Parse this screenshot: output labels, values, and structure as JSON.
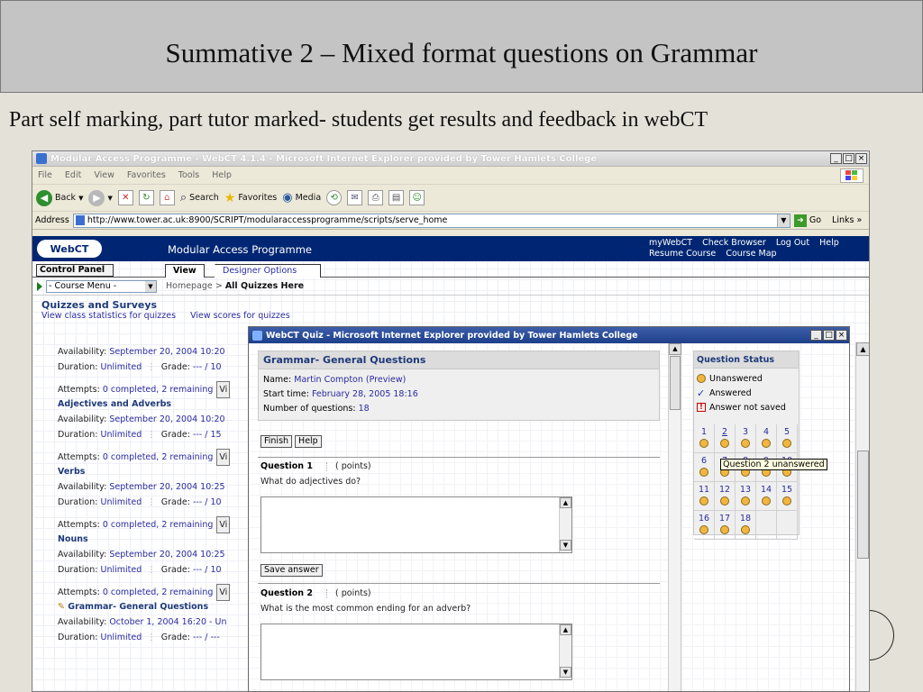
{
  "slide": {
    "title": "Summative 2 – Mixed format questions on Grammar",
    "subtitle": "Part self marking, part tutor marked- students get results and feedback  in webCT"
  },
  "browser": {
    "title": "Modular Access Programme - WebCT 4.1.4 - Microsoft Internet Explorer provided by Tower Hamlets College",
    "window_buttons": [
      "_",
      "□",
      "×"
    ],
    "menu": [
      "File",
      "Edit",
      "View",
      "Favorites",
      "Tools",
      "Help"
    ],
    "toolbar": {
      "back": "Back",
      "search": "Search",
      "favorites": "Favorites",
      "media": "Media"
    },
    "address_label": "Address",
    "url": "http://www.tower.ac.uk:8900/SCRIPT/modularaccessprogramme/scripts/serve_home",
    "go": "Go",
    "links": "Links"
  },
  "webct": {
    "logo": "WebCT",
    "course_title": "Modular Access Programme",
    "top_links": [
      "myWebCT",
      "Check Browser",
      "Log Out",
      "Help"
    ],
    "top_links2": [
      "Resume Course",
      "Course Map"
    ],
    "control_panel": "Control Panel",
    "tab_view": "View",
    "tab_designer": "Designer Options",
    "course_menu": "- Course Menu -",
    "breadcrumb_home": "Homepage",
    "breadcrumb_sep": ">",
    "breadcrumb_current": "All Quizzes Here",
    "section_title": "Quizzes and Surveys",
    "stats_link": "View class statistics for quizzes",
    "scores_link": "View scores for quizzes",
    "quizzes": [
      {
        "name": "",
        "availability_label": "Availability:",
        "availability": "September 20, 2004 10:20",
        "duration_label": "Duration:",
        "duration": "Unlimited",
        "grade_label": "Grade:",
        "grade": "--- / 10",
        "attempts_label": "Attempts:",
        "attempts": "0 completed, 2 remaining",
        "view_btn": "Vi"
      },
      {
        "name": "Adjectives and Adverbs",
        "availability_label": "Availability:",
        "availability": "September 20, 2004 10:20",
        "duration_label": "Duration:",
        "duration": "Unlimited",
        "grade_label": "Grade:",
        "grade": "--- / 15",
        "attempts_label": "Attempts:",
        "attempts": "0 completed, 2 remaining",
        "view_btn": "Vi"
      },
      {
        "name": "Verbs",
        "availability_label": "Availability:",
        "availability": "September 20, 2004 10:25",
        "duration_label": "Duration:",
        "duration": "Unlimited",
        "grade_label": "Grade:",
        "grade": "--- / 10",
        "attempts_label": "Attempts:",
        "attempts": "0 completed, 2 remaining",
        "view_btn": "Vi"
      },
      {
        "name": "Nouns",
        "availability_label": "Availability:",
        "availability": "September 20, 2004 10:25",
        "duration_label": "Duration:",
        "duration": "Unlimited",
        "grade_label": "Grade:",
        "grade": "--- / 10",
        "attempts_label": "Attempts:",
        "attempts": "0 completed, 2 remaining",
        "view_btn": "Vi"
      },
      {
        "name": "Grammar- General Questions",
        "availability_label": "Availability:",
        "availability": "October 1, 2004 16:20 - Un",
        "duration_label": "Duration:",
        "duration": "Unlimited",
        "grade_label": "Grade:",
        "grade": "--- / ---"
      }
    ]
  },
  "popup": {
    "title": "WebCT Quiz - Microsoft Internet Explorer provided by Tower Hamlets College",
    "quiz_title": "Grammar- General Questions",
    "name_label": "Name:",
    "name": "Martin Compton (Preview)",
    "start_label": "Start time:",
    "start": "February 28, 2005 18:16",
    "count_label": "Number of questions:",
    "count": "18",
    "finish": "Finish",
    "help": "Help",
    "questions": [
      {
        "label": "Question 1",
        "points": "( points)",
        "text": "What do adjectives do?",
        "save": "Save answer"
      },
      {
        "label": "Question 2",
        "points": "( points)",
        "text": "What is the most common ending for an adverb?"
      }
    ],
    "status_title": "Question Status",
    "legend": [
      "Unanswered",
      "Answered",
      "Answer not saved"
    ],
    "grid": [
      [
        "1",
        "2",
        "3",
        "4",
        "5"
      ],
      [
        "6",
        "7",
        "8",
        "9",
        "10"
      ],
      [
        "11",
        "12",
        "13",
        "14",
        "15"
      ],
      [
        "16",
        "17",
        "18"
      ]
    ],
    "tooltip": "Question 2 unanswered"
  }
}
